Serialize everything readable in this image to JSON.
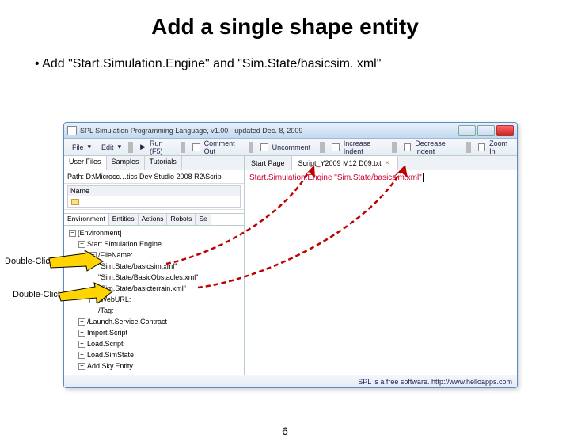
{
  "slide": {
    "title": "Add a single shape entity",
    "bullet": "Add \"Start.Simulation.Engine\" and \"Sim.State/basicsim. xml\"",
    "page_number": "6"
  },
  "callouts": {
    "dbl1": "Double-Click",
    "dbl2": "Double-Click"
  },
  "window": {
    "title": "SPL Simulation Programming Language, v1.00 - updated Dec. 8, 2009",
    "winbtn_min": "_",
    "winbtn_max": "□",
    "winbtn_close": "X",
    "menubar": {
      "file": "File",
      "edit": "Edit",
      "run": "Run (F5)",
      "comment_out": "Comment Out",
      "uncomment": "Uncomment",
      "increase_indent": "Increase Indent",
      "decrease_indent": "Decrease Indent",
      "zoom_in": "Zoom In"
    },
    "left": {
      "tabs": {
        "user_files": "User Files",
        "samples": "Samples",
        "tutorials": "Tutorials"
      },
      "path_label": "Path:",
      "path_value": "D:\\Microcc…tics Dev Studio 2008 R2\\Scrip",
      "name_label": "Name",
      "name_value": "..",
      "env_tabs": {
        "environment": "Environment",
        "entities": "Entities",
        "actions": "Actions",
        "robots": "Robots",
        "se": "Se"
      },
      "tree": {
        "root": "[Environment]",
        "start_sim": "Start.Simulation.Engine",
        "filename_hdr": "/FileName:",
        "files": [
          "\"Sim.State/basicsim.xml\"",
          "\"Sim.State/BasicObstacles.xml\"",
          "\"Sim.State/basicterrain.xml\""
        ],
        "weburl": "/WebURL:",
        "tag": "/Tag:",
        "launch": "/Launch.Service.Contract",
        "import": "Import.Script",
        "load_script": "Load.Script",
        "load_simstate": "Load.SimState",
        "add_sky": "Add.Sky.Entity"
      }
    },
    "right": {
      "tabs": {
        "start_page": "Start Page",
        "script": "Script_Y2009 M12 D09.txt"
      },
      "code_line": "Start.Simulation.Engine \"Sim.State/basicsim.xml\""
    },
    "footer": "SPL is a free software.  http://www.helloapps.com"
  }
}
